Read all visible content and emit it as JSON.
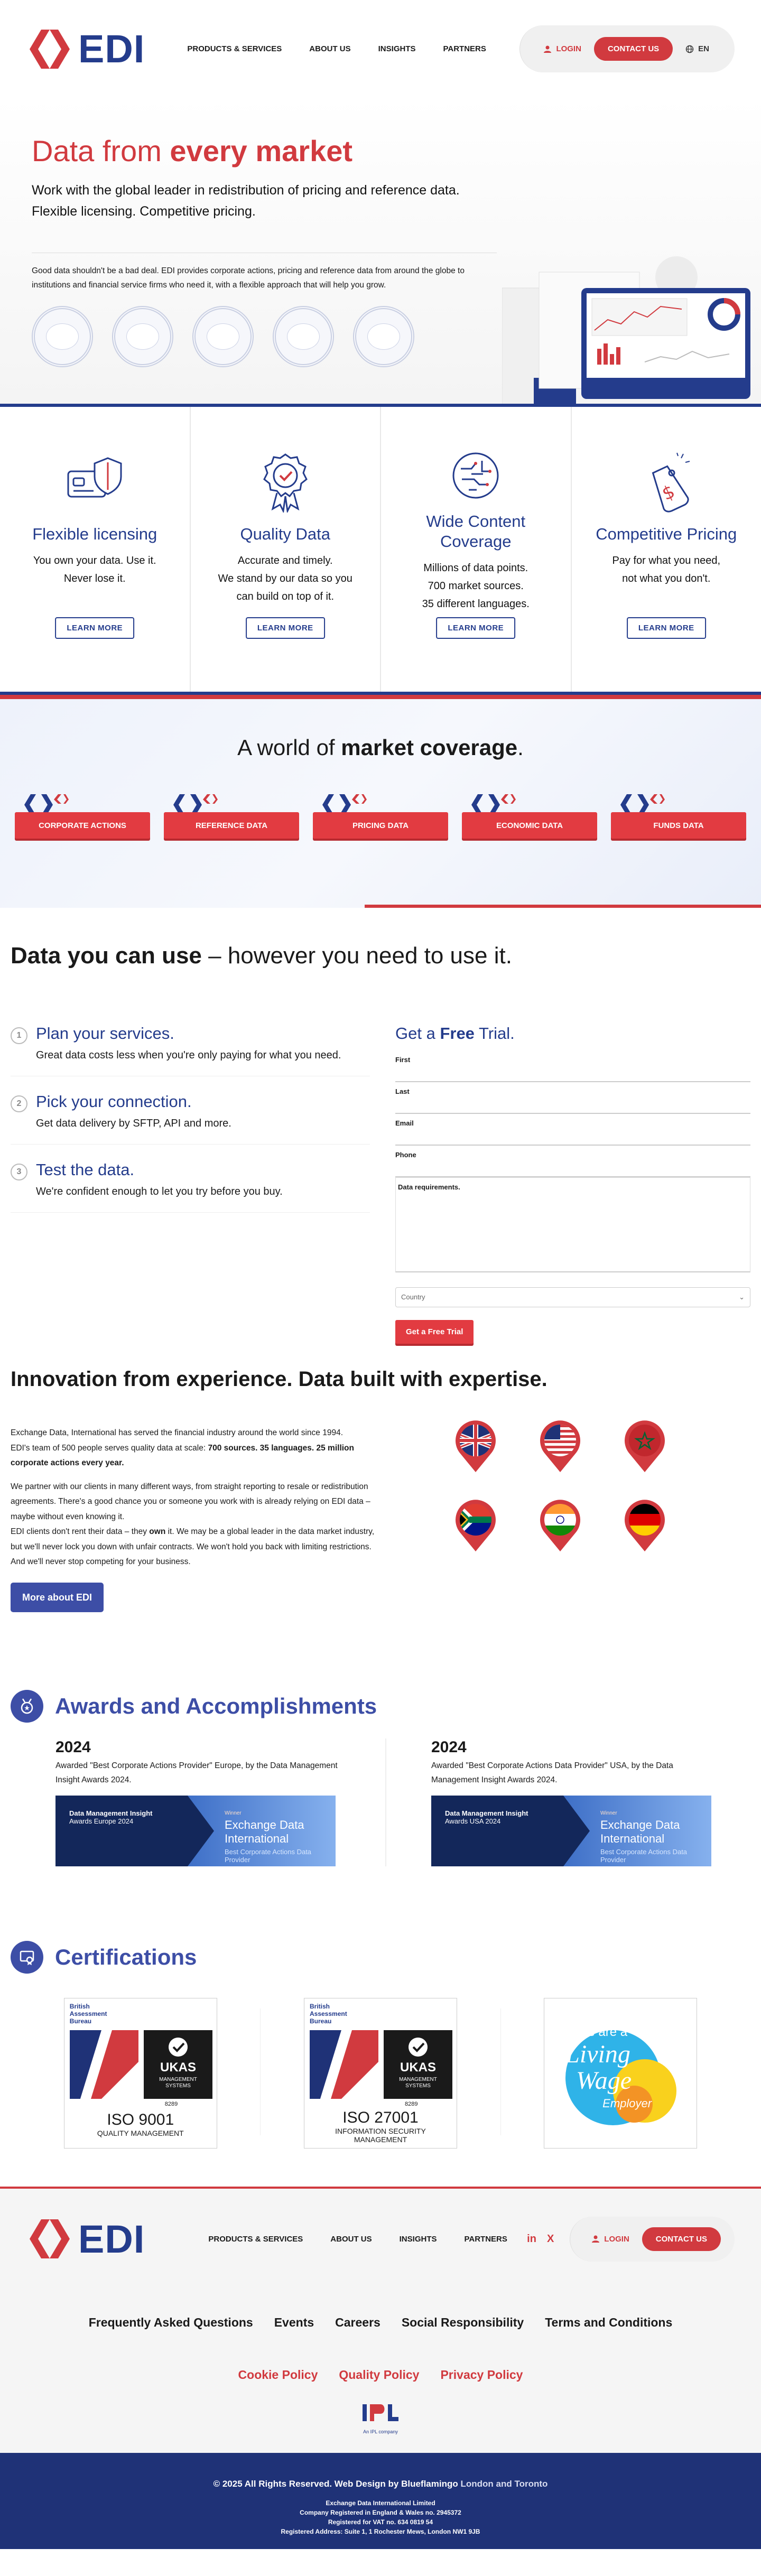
{
  "brand": {
    "logo_text": "EDI",
    "red": "#d13a3f",
    "navy": "#243c8c"
  },
  "header": {
    "nav": [
      "PRODUCTS & SERVICES",
      "ABOUT US",
      "INSIGHTS",
      "PARTNERS"
    ],
    "login": "LOGIN",
    "contact": "CONTACT US",
    "lang": "EN"
  },
  "hero": {
    "title_plain": "Data from ",
    "title_bold": "every market",
    "lead1": "Work with the global leader in redistribution of pricing and reference data.",
    "lead2": "Flexible licensing. Competitive pricing.",
    "body": "Good data shouldn't be a bad deal. EDI provides corporate actions, pricing and reference data from around the globe to institutions and financial service firms who need it, with a flexible approach that will help you grow.",
    "badge_count": 5
  },
  "features": [
    {
      "icon": "card-shield-icon",
      "title": "Flexible licensing",
      "line1": "You own your data. Use it.",
      "line2": "Never lose it.",
      "line3": "",
      "button": "LEARN MORE"
    },
    {
      "icon": "award-ribbon-icon",
      "title": "Quality Data",
      "line1": "Accurate and timely.",
      "line2": "We stand by our data so you",
      "line3": "can build on top of it.",
      "button": "LEARN MORE"
    },
    {
      "icon": "circuit-globe-icon",
      "title": "Wide Content Coverage",
      "line1": "Millions of data points.",
      "line2": "700 market sources.",
      "line3": "35 different languages.",
      "button": "LEARN MORE"
    },
    {
      "icon": "price-tag-icon",
      "title": "Competitive Pricing",
      "line1": "Pay for what you need,",
      "line2": "not what you don't.",
      "line3": "",
      "button": "LEARN MORE"
    }
  ],
  "coverage": {
    "title_plain": "A world of ",
    "title_bold": "market coverage",
    "title_end": ".",
    "tabs": [
      "CORPORATE ACTIONS",
      "REFERENCE DATA",
      "PRICING DATA",
      "ECONOMIC DATA",
      "FUNDS DATA"
    ]
  },
  "use": {
    "title_bold": "Data you can use",
    "title_rest": " – however you need to use it.",
    "steps": [
      {
        "num": "1",
        "title": "Plan your services.",
        "text": "Great data costs less when you're only paying for what you need."
      },
      {
        "num": "2",
        "title": "Pick your connection.",
        "text": "Get data delivery by SFTP, API and more."
      },
      {
        "num": "3",
        "title": "Test the data.",
        "text": "We're confident enough to let you try before you buy."
      }
    ],
    "trial": {
      "title_a": "Get a ",
      "title_b": "Free",
      "title_c": " Trial.",
      "fields": [
        "First",
        "Last",
        "Email",
        "Phone"
      ],
      "area": "Data requirements.",
      "country": "Country",
      "submit": "Get a Free Trial"
    }
  },
  "innovation": {
    "title": "Innovation from experience. Data built with expertise.",
    "p1": "Exchange Data, International has served the financial industry around the world since 1994.",
    "p1b": "EDI's team of 500 people serves quality data at scale: ",
    "p1c": "700 sources. 35 languages. 25 million corporate actions every year.",
    "p2": "We partner with our clients in many different ways, from straight reporting to resale or redistribution agreements. There's a good chance you or someone you work with is already relying on EDI data – maybe without even knowing it.",
    "p3a": "EDI clients don't rent their data – they ",
    "p3b": "own",
    "p3c": " it. We may be a global leader in the data market industry, but we'll never lock you down with unfair contracts. We won't hold you back with limiting restrictions. And we'll never stop competing for your business.",
    "button": "More about EDI",
    "flags": [
      "uk-flag-icon",
      "usa-flag-icon",
      "morocco-flag-icon",
      "south-africa-flag-icon",
      "india-flag-icon",
      "germany-flag-icon"
    ]
  },
  "awards": {
    "title": "Awards and Accomplishments",
    "items": [
      {
        "year": "2024",
        "text": "Awarded \"Best Corporate Actions Provider\" Europe, by the Data Management Insight Awards 2024.",
        "banner_left": "Data Management Insight",
        "banner_sub": "Awards Europe 2024",
        "banner_winner": "Winner",
        "banner_title": "Exchange Data International",
        "banner_cat": "Best Corporate Actions Data Provider"
      },
      {
        "year": "2024",
        "text": "Awarded \"Best Corporate Actions Data Provider\" USA, by the Data Management Insight Awards 2024.",
        "banner_left": "Data Management Insight",
        "banner_sub": "Awards USA 2024",
        "banner_winner": "Winner",
        "banner_title": "Exchange Data International",
        "banner_cat": "Best Corporate Actions Data Provider"
      }
    ]
  },
  "certs": {
    "title": "Certifications",
    "items": [
      {
        "bab": "British Assessment Bureau",
        "num": "8289",
        "iso": "ISO 9001",
        "desc1": "QUALITY MANAGEMENT",
        "desc2": ""
      },
      {
        "bab": "British Assessment Bureau",
        "num": "8289",
        "iso": "ISO 27001",
        "desc1": "INFORMATION SECURITY",
        "desc2": "MANAGEMENT"
      }
    ],
    "living_wage": {
      "line1": "We are a",
      "line2": "Living",
      "line3": "Wage",
      "line4": "Employer"
    }
  },
  "footer": {
    "nav": [
      "PRODUCTS & SERVICES",
      "ABOUT US",
      "INSIGHTS",
      "PARTNERS"
    ],
    "social": [
      "in",
      "X"
    ],
    "login": "LOGIN",
    "contact": "CONTACT US",
    "links": [
      "Frequently Asked Questions",
      "Events",
      "Careers",
      "Social Responsibility",
      "Terms and Conditions"
    ],
    "policies": [
      "Cookie Policy",
      "Quality Policy",
      "Privacy Policy"
    ],
    "ipl_sub": "An IPL company",
    "copyright_a": "© 2025 All Rights Reserved. Web Design by ",
    "copyright_b": "Blueflamingo",
    "copyright_c": " London and Toronto",
    "legal1": "Exchange Data International Limited",
    "legal2": "Company Registered in England & Wales no. 2945372",
    "legal3": "Registered for VAT no. 634 0819 54",
    "legal4": "Registered Address: Suite 1, 1 Rochester Mews, London NW1 9JB"
  }
}
